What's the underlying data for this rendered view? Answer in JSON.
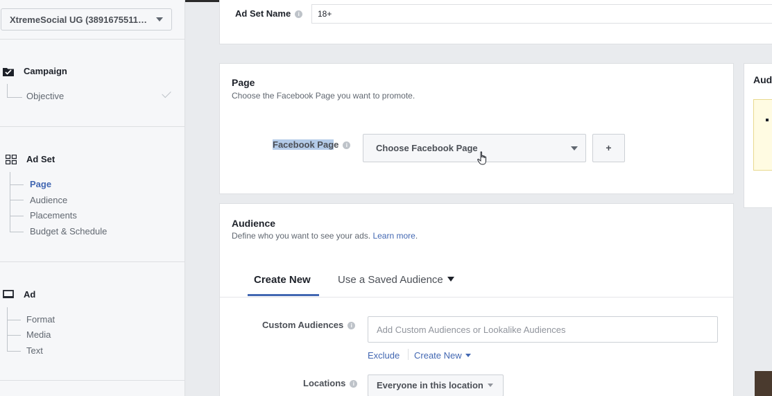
{
  "sidebar": {
    "account": "XtremeSocial UG (3891675511…",
    "campaign": {
      "title": "Campaign",
      "items": [
        "Objective"
      ]
    },
    "adset": {
      "title": "Ad Set",
      "items": [
        "Page",
        "Audience",
        "Placements",
        "Budget & Schedule"
      ],
      "active": "Page"
    },
    "ad": {
      "title": "Ad",
      "items": [
        "Format",
        "Media",
        "Text"
      ]
    }
  },
  "adset_name": {
    "label": "Ad Set Name",
    "value": "18+"
  },
  "page_section": {
    "title": "Page",
    "description": "Choose the Facebook Page you want to promote.",
    "field_label_highlight": "Facebook Pag",
    "field_label_rest": "e",
    "select_value": "Choose Facebook Page",
    "add_label": "+"
  },
  "audience_section": {
    "title": "Audience",
    "description": "Define who you want to see your ads. ",
    "learn_more": "Learn more",
    "period": ".",
    "tabs": {
      "create_new": "Create New",
      "saved": "Use a Saved Audience"
    },
    "custom_audiences": {
      "label": "Custom Audiences",
      "placeholder": "Add Custom Audiences or Lookalike Audiences",
      "exclude": "Exclude",
      "create_new": "Create New"
    },
    "locations": {
      "label": "Locations",
      "value": "Everyone in this location"
    }
  },
  "right_panel": {
    "title": "Aud"
  },
  "colors": {
    "accent": "#4267b2",
    "bg": "#e9ebee",
    "highlight": "#b4cbe8"
  },
  "icons": [
    "campaign-check-icon",
    "adset-grid-icon",
    "ad-monitor-icon",
    "info-icon",
    "checkmark-icon",
    "hand-cursor-icon"
  ]
}
